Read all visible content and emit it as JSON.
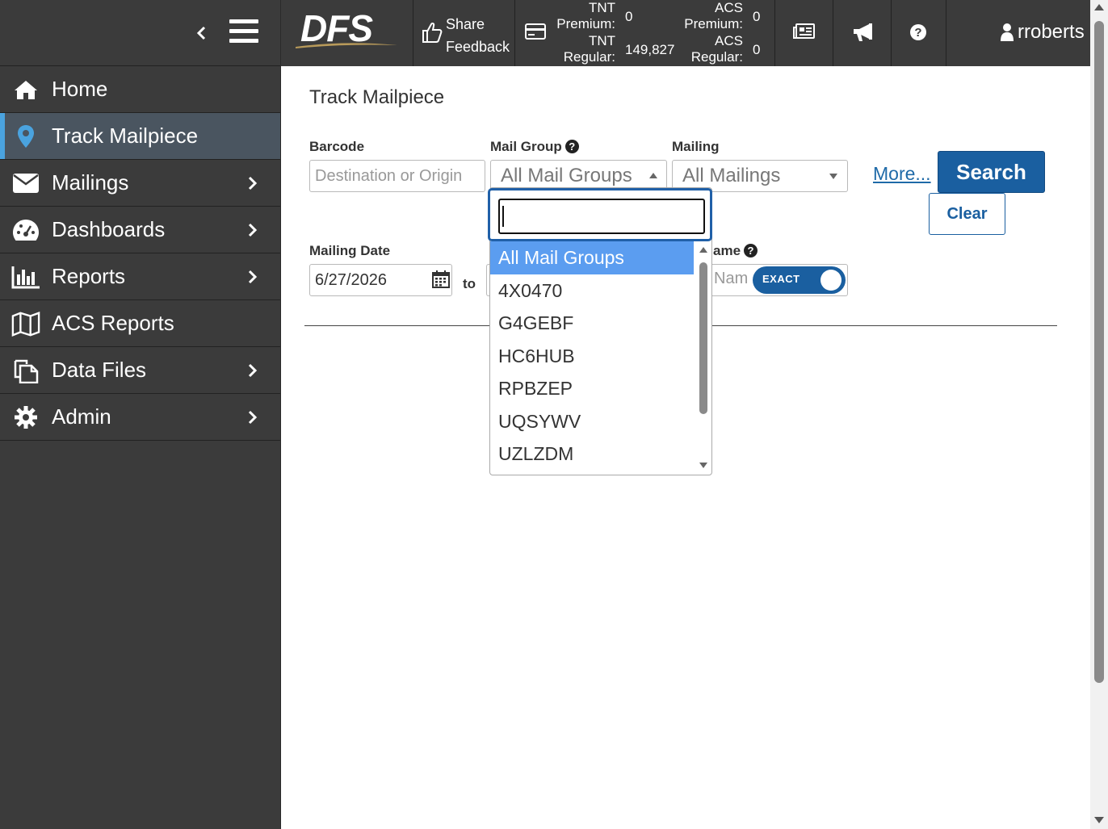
{
  "sidebar": {
    "items": [
      {
        "label": "Home",
        "icon": "home-icon",
        "has_submenu": false,
        "active": false
      },
      {
        "label": "Track Mailpiece",
        "icon": "map-marker-icon",
        "has_submenu": false,
        "active": true
      },
      {
        "label": "Mailings",
        "icon": "envelope-icon",
        "has_submenu": true,
        "active": false
      },
      {
        "label": "Dashboards",
        "icon": "dashboard-icon",
        "has_submenu": true,
        "active": false
      },
      {
        "label": "Reports",
        "icon": "bar-chart-icon",
        "has_submenu": true,
        "active": false
      },
      {
        "label": "ACS Reports",
        "icon": "map-icon",
        "has_submenu": false,
        "active": false
      },
      {
        "label": "Data Files",
        "icon": "files-icon",
        "has_submenu": true,
        "active": false
      },
      {
        "label": "Admin",
        "icon": "gear-icon",
        "has_submenu": true,
        "active": false
      }
    ]
  },
  "header": {
    "logo_text": "DFS",
    "feedback": {
      "line1": "Share",
      "line2": "Feedback"
    },
    "counts": {
      "tnt_premium_label": [
        "TNT",
        "Premium:"
      ],
      "tnt_premium_value": "0",
      "tnt_regular_label": [
        "TNT",
        "Regular:"
      ],
      "tnt_regular_value": "149,827",
      "acs_premium_label": [
        "ACS",
        "Premium:"
      ],
      "acs_premium_value": "0",
      "acs_regular_label": [
        "ACS",
        "Regular:"
      ],
      "acs_regular_value": "0"
    },
    "icons": [
      "newspaper-icon",
      "megaphone-icon",
      "question-icon"
    ],
    "username": "rroberts"
  },
  "main": {
    "title": "Track Mailpiece",
    "barcode": {
      "label": "Barcode",
      "placeholder": "Destination or Origin"
    },
    "mail_group": {
      "label": "Mail Group",
      "value": "All Mail Groups"
    },
    "mailing": {
      "label": "Mailing",
      "value": "All Mailings"
    },
    "more_link": "More...",
    "search_button": "Search",
    "clear_button": "Clear",
    "mailing_date": {
      "label": "Mailing Date",
      "value": "6/27/2026",
      "to_label": "to"
    },
    "name_field": {
      "label_partial": "ame",
      "placeholder_partial": "Nam"
    },
    "exact_toggle": {
      "label": "EXACT",
      "on": true
    }
  },
  "dropdown": {
    "search_value": "",
    "options": [
      "All Mail Groups",
      "4X0470",
      "G4GEBF",
      "HC6HUB",
      "RPBZEP",
      "UQSYWV",
      "UZLZDM"
    ],
    "selected_index": 0
  },
  "colors": {
    "sidebar_bg": "#3b3b3b",
    "active_accent": "#4aa3df",
    "primary": "#1a5fa0",
    "selected_option": "#5b9df0"
  }
}
